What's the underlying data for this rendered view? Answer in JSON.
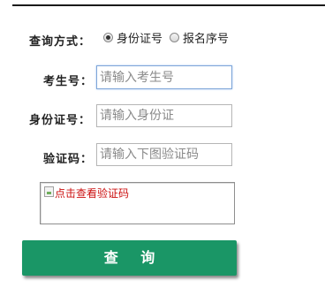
{
  "form": {
    "query_method_label": "查询方式：",
    "query_options": [
      {
        "label": "身份证号",
        "checked": true
      },
      {
        "label": "报名序号",
        "checked": false
      }
    ],
    "exam_number": {
      "label": "考生号：",
      "value": "",
      "placeholder": "请输入考生号"
    },
    "id_number": {
      "label": "身份证号：",
      "value": "",
      "placeholder": "请输入身份证"
    },
    "verify_code": {
      "label": "验证码：",
      "value": "",
      "placeholder": "请输入下图验证码"
    },
    "captcha": {
      "alt_text": "点击查看验证码",
      "icon": "broken-image-icon"
    },
    "submit_label": "查 询"
  },
  "colors": {
    "submit_bg": "#1a9666",
    "captcha_text": "#cc1111",
    "focus_border": "#7fa6d9"
  }
}
